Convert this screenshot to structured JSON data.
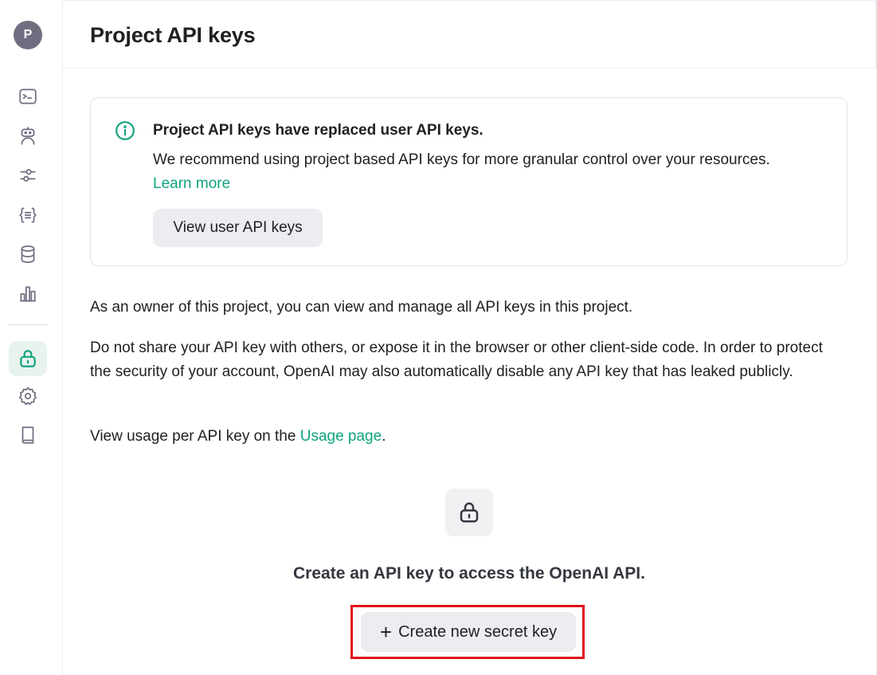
{
  "user": {
    "avatar_initial": "P"
  },
  "header": {
    "title": "Project API keys"
  },
  "sidebar": {
    "items": [
      {
        "name": "playground",
        "icon": "terminal-icon"
      },
      {
        "name": "assistants",
        "icon": "robot-icon"
      },
      {
        "name": "fine-tuning",
        "icon": "sliders-icon"
      },
      {
        "name": "batches",
        "icon": "braces-icon"
      },
      {
        "name": "storage",
        "icon": "database-icon"
      },
      {
        "name": "usage",
        "icon": "bar-chart-icon"
      },
      {
        "name": "api-keys",
        "icon": "lock-icon",
        "active": true
      },
      {
        "name": "settings",
        "icon": "gear-icon"
      },
      {
        "name": "docs",
        "icon": "book-icon"
      }
    ]
  },
  "notice": {
    "title": "Project API keys have replaced user API keys.",
    "body": "We recommend using project based API keys for more granular control over your resources.",
    "link": "Learn more",
    "button": "View user API keys"
  },
  "content": {
    "owner_text": "As an owner of this project, you can view and manage all API keys in this project.",
    "security_text": "Do not share your API key with others, or expose it in the browser or other client-side code. In order to protect the security of your account, OpenAI may also automatically disable any API key that has leaked publicly.",
    "usage_prefix": "View usage per API key on the",
    "usage_link": "Usage page",
    "usage_suffix": "."
  },
  "empty_state": {
    "title": "Create an API key to access the OpenAI API.",
    "button_icon": "+",
    "button": "Create new secret key"
  },
  "colors": {
    "accent": "#10a37f",
    "highlight": "#e0101a"
  }
}
